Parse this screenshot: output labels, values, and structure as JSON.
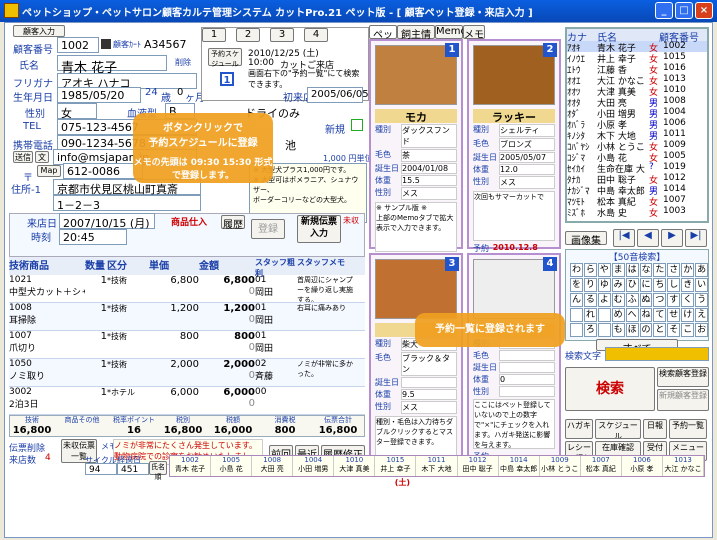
{
  "window": {
    "title": "ペットショップ・ペットサロン顧客カルテ管理システム カットPro.21 ペット版 - [ 顧客ペット登録・来店入力 ]",
    "min": "_",
    "max": "□",
    "close": "×"
  },
  "customer": {
    "new_btn": "顧客入力",
    "id_label": "顧客番号",
    "id": "1002",
    "id2_label": "顧客ｶｰﾄﾞ",
    "id2": "A34567",
    "name_label": "氏名",
    "name": "青木 花子",
    "delete": "削除",
    "kana_label": "フリガナ",
    "kana": "アオキ ハナコ",
    "birth_label": "生年月日",
    "birth": "1985/05/20",
    "age": "24",
    "age_unit": "歳",
    "month": "0",
    "month_unit": "ヶ月",
    "gender_label": "性別",
    "gender": "女",
    "blood_label": "血液型",
    "blood": "B",
    "tel_label": "TEL",
    "tel": "075-123-4567",
    "mobile_label": "携帯電話",
    "mobile": "090-1234-5678",
    "mail_btn": "送信",
    "mail_btn2": "文",
    "email": "info@msjapan.jp",
    "zip_label": "〒",
    "zip": "612-0086",
    "addr_label": "住所-1",
    "map_btn": "Map",
    "addr1": "京都市伏見区桃山町真斎",
    "addr2": "1－2－3",
    "first_visit": "初来店",
    "first_visit_date": "2005/06/05",
    "shop_label": "ドライのみ",
    "new_label": "新規",
    "pond_label": "池",
    "price": "1,000 円単位",
    "memo": "※ 大型犬プラス1,000円です。\n※ 大型可はポメラニア、シュナウザー、\nボーダーコリーなどの大型犬。\n\n20㎏の大型犬は 1時間です\n入浴シャンプー・仕上げで30分\n50m新規店の場合\n\n※ サンプル版 ※\nグリーンの背景色ではクリ"
  },
  "tabs": [
    "1",
    "2",
    "3",
    "4"
  ],
  "schedule": {
    "btn": "予約スケジュール",
    "date": "2010/12/25 (土)",
    "time": "10:00",
    "text": "カットご来店",
    "note": "画面右下の\"予約一覧\"にて検索できます。"
  },
  "visit": {
    "label": "来店日",
    "date": "2007/10/15 (月)",
    "time_label": "時刻",
    "time": "20:45",
    "product_btn": "商品仕入",
    "history_btn": "履歴",
    "copy_btn": "登録",
    "new_entry_btn": "新規伝票入力",
    "unreg": "未収",
    "headers": [
      "技術商品",
      "数量",
      "区分",
      "単価",
      "金額",
      "原単価",
      "スタッフ粗利",
      "スタッフメモ"
    ],
    "rows": [
      {
        "code": "1021",
        "name": "中型犬カット＋シャンプー",
        "qty": "1",
        "cat": "*技術",
        "price": "6,800",
        "amount": "6,800",
        "cost": "0",
        "staff": "01",
        "staffname": "岡田",
        "memo": "首周辺にシャンプーを繰り返し実施する。"
      },
      {
        "code": "1008",
        "name": "耳掃除",
        "qty": "1",
        "cat": "*技術",
        "price": "1,200",
        "amount": "1,200",
        "cost": "0",
        "staff": "01",
        "staffname": "岡田",
        "memo": "右耳に痛みあり"
      },
      {
        "code": "1007",
        "name": "爪切り",
        "qty": "1",
        "cat": "*技術",
        "price": "800",
        "amount": "800",
        "cost": "0",
        "staff": "01",
        "staffname": "岡田",
        "memo": ""
      },
      {
        "code": "1050",
        "name": "ノミ取り",
        "qty": "1",
        "cat": "*技術",
        "price": "2,000",
        "amount": "2,000",
        "cost": "0",
        "staff": "02",
        "staffname": "斉藤",
        "memo": "ノミが非常に多かった。"
      },
      {
        "code": "3002",
        "name": "2泊3日",
        "qty": "1",
        "cat": "*ホテル",
        "price": "6,000",
        "amount": "6,000",
        "cost": "0",
        "staff": "00",
        "staffname": "",
        "memo": ""
      }
    ],
    "totals_labels": [
      "技術",
      "商品その他",
      "税率ポイント",
      "税別",
      "税額",
      "消費税",
      "伝票合計"
    ],
    "totals": [
      "16,800",
      "",
      "16",
      "16,800",
      "16,000",
      "800",
      "16,800"
    ],
    "slip_delete": "伝票削除",
    "unpaid": "未収伝票一覧",
    "visits_label": "来店数",
    "visits": "4",
    "memo_label": "メモ",
    "memo_text": "ノミが非常にたくさん発生しています。動物病院での診察をお勧めいたしました。(レシートで印刷も可能)",
    "prev_btn": "前回",
    "recent_btn": "最近",
    "history_fix_btn": "履歴修正"
  },
  "pet_tabs": [
    "ペット",
    "飼主情報",
    "Memo",
    "メモ"
  ],
  "pets": [
    {
      "no": "1",
      "name": "モカ",
      "breed": "ダックスフンド",
      "size": "中型",
      "color": "茶",
      "sex": "メス",
      "birth": "2004/01/08",
      "weight": "15.5",
      "vaccine": "2010.12.25 (土)"
    },
    {
      "no": "2",
      "name": "ラッキー",
      "breed": "シェルティ",
      "size": "小型",
      "color": "ブロンズ",
      "sex": "メス",
      "birth": "2005/05/07",
      "weight": "12.0",
      "vaccine": "2010.12.8 (水)"
    },
    {
      "no": "3",
      "name": "",
      "breed": "柴犬",
      "size": "",
      "color": "ブラック＆タン",
      "sex": "メス",
      "birth": "",
      "weight": "9.5",
      "vaccine": "2011.1.15 (土)"
    },
    {
      "no": "4",
      "name": "",
      "breed": "",
      "size": "",
      "color": "",
      "sex": "",
      "birth": "",
      "weight": "0",
      "vaccine": ""
    }
  ],
  "pet_memo": {
    "m1": "※ サンプル版 ※\n上部のMemoタブで拡大表示で入力できます。",
    "m2": "次回もサマーカットで",
    "m3": "種別・毛色は入力待ちダブルクリックするとマスター登録できます。",
    "m4": "ここにはペット登録していないので上の数字で\"×\"にチェックを入れます。ハガキ発送に影響を与えます。",
    "label_name": "種別",
    "label_color": "毛色",
    "label_birth": "誕生日",
    "label_weight": "体重",
    "label_sex": "性別",
    "label_reserve": "予約"
  },
  "customers": {
    "headers": [
      "カナ",
      "氏名",
      "顧客番号"
    ],
    "rows": [
      [
        "ｱｵｷ",
        "青木 花子",
        "女",
        "1002"
      ],
      [
        "ｲﾉｳｴ",
        "井上 幸子",
        "女",
        "1015"
      ],
      [
        "ｴﾄｳ",
        "江藤 香",
        "女",
        "1016"
      ],
      [
        "ｵｵｴ",
        "大江 かなこ",
        "女",
        "1013"
      ],
      [
        "ｵｵﾂ",
        "大津 真美",
        "女",
        "1010"
      ],
      [
        "ｵｵﾀ",
        "大田 亮",
        "男",
        "1008"
      ],
      [
        "ｵﾀﾞ",
        "小田 増男",
        "男",
        "1004"
      ],
      [
        "ｵﾊﾞﾗ",
        "小原 孝",
        "男",
        "1006"
      ],
      [
        "ｷﾉｼﾀ",
        "木下 大地",
        "男",
        "1011"
      ],
      [
        "ｺﾊﾞﾔｼ",
        "小林 とうこ",
        "女",
        "1009"
      ],
      [
        "ｺｼﾞﾏ",
        "小島 花",
        "女",
        "1005"
      ],
      [
        "ｾｲｶｲ",
        "生命在庫 大",
        "?",
        "1019"
      ],
      [
        "ﾀﾅｶ",
        "田中 聡子",
        "女",
        "1012"
      ],
      [
        "ﾅｶｼﾞﾏ",
        "中島 幸太郎",
        "男",
        "1014"
      ],
      [
        "ﾏﾂﾓﾄ",
        "松本 真紀",
        "女",
        "1007"
      ],
      [
        "ﾐｽﾞﾎ",
        "水島 史",
        "女",
        "1003"
      ]
    ],
    "photo_btn": "画像集",
    "nav": [
      "|◀",
      "◀",
      "▶",
      "▶|"
    ]
  },
  "kana_search": {
    "title": "【50音検索】",
    "rows": [
      [
        "わ",
        "ら",
        "や",
        "ま",
        "は",
        "な",
        "た",
        "さ",
        "か",
        "あ"
      ],
      [
        "を",
        "り",
        "ゆ",
        "み",
        "ひ",
        "に",
        "ち",
        "し",
        "き",
        "い"
      ],
      [
        "ん",
        "る",
        "よ",
        "む",
        "ふ",
        "ぬ",
        "つ",
        "す",
        "く",
        "う"
      ],
      [
        "",
        "れ",
        "",
        "め",
        "へ",
        "ね",
        "て",
        "せ",
        "け",
        "え"
      ],
      [
        "",
        "ろ",
        "",
        "も",
        "ほ",
        "の",
        "と",
        "そ",
        "こ",
        "お"
      ]
    ],
    "all": "すべて",
    "search_label": "検索文字",
    "search_btn": "検索",
    "customer_reg": "検索顧客登録",
    "new_customer": "新規顧客登録"
  },
  "bottom_buttons": [
    "ハガキ",
    "スケジュール",
    "日報",
    "予約一覧",
    "レシート領収書",
    "在庫確認",
    "受付",
    "メニュー"
  ],
  "status": {
    "cycle_label": "サイクル",
    "period_label": "経過日",
    "cycle": "94",
    "period": "451",
    "sort": "氏名順",
    "sort_btn": "降順"
  },
  "history": [
    {
      "no": "1002",
      "name": "青木 花子"
    },
    {
      "no": "1005",
      "name": "小島 花"
    },
    {
      "no": "1008",
      "name": "大田 亮"
    },
    {
      "no": "1004",
      "name": "小田 増男"
    },
    {
      "no": "1010",
      "name": "大津 真美"
    },
    {
      "no": "1015",
      "name": "井上 幸子"
    },
    {
      "no": "1011",
      "name": "木下 大地"
    },
    {
      "no": "1012",
      "name": "田中 聡子"
    },
    {
      "no": "1014",
      "name": "中島 幸太郎"
    },
    {
      "no": "1009",
      "name": "小林 とうこ"
    },
    {
      "no": "1007",
      "name": "松本 真紀"
    },
    {
      "no": "1006",
      "name": "小原 孝"
    },
    {
      "no": "1013",
      "name": "大江 かなこ"
    }
  ],
  "callouts": {
    "c1_title": "ボタンクリックで",
    "c1_body": "予約スケジュールに登録",
    "c1_note": "メモの先頭は 09:30 15:30 形式で登録します。",
    "c2": "予約一覧に登録されます"
  },
  "colors": {
    "accent": "#1a3ea8",
    "callout": "#f0a020",
    "title": "#0a5fe0"
  }
}
